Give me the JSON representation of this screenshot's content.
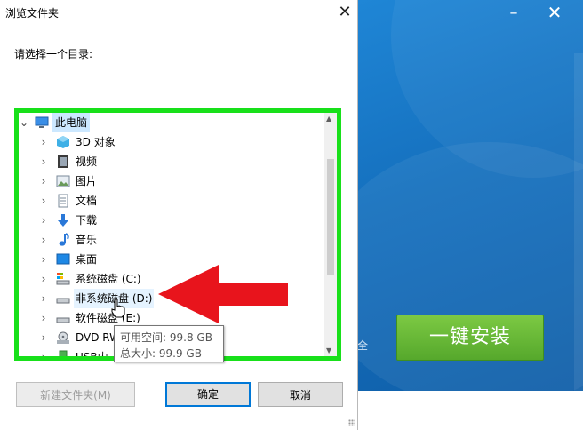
{
  "dialog": {
    "title": "浏览文件夹",
    "prompt": "请选择一个目录:",
    "tree": [
      {
        "label": "此电脑",
        "icon": "computer-icon",
        "expanded": true,
        "selected": true
      },
      {
        "label": "3D 对象",
        "icon": "3d-objects-icon"
      },
      {
        "label": "视频",
        "icon": "video-icon"
      },
      {
        "label": "图片",
        "icon": "pictures-icon"
      },
      {
        "label": "文档",
        "icon": "documents-icon"
      },
      {
        "label": "下载",
        "icon": "downloads-icon"
      },
      {
        "label": "音乐",
        "icon": "music-icon"
      },
      {
        "label": "桌面",
        "icon": "desktop-icon"
      },
      {
        "label": "系统磁盘 (C:)",
        "icon": "system-drive-icon"
      },
      {
        "label": "非系统磁盘 (D:)",
        "icon": "drive-icon",
        "hovered": true
      },
      {
        "label": "软件磁盘 (E:)",
        "icon": "drive-icon"
      },
      {
        "label": "DVD RW",
        "icon": "dvd-drive-icon"
      },
      {
        "label": "USB内",
        "icon": "usb-drive-icon"
      }
    ],
    "tooltip": {
      "free_space": "可用空间: 99.8 GB",
      "total_size": "总大小: 99.9 GB"
    },
    "buttons": {
      "new_folder": "新建文件夹(M)",
      "ok": "确定",
      "cancel": "取消"
    }
  },
  "installer": {
    "install_button": "一键安装",
    "partial_text": "全",
    "minimize": "–",
    "close": "✕"
  },
  "annotations": {
    "highlight_color": "#18e01a",
    "arrow_color": "#e8141c"
  }
}
